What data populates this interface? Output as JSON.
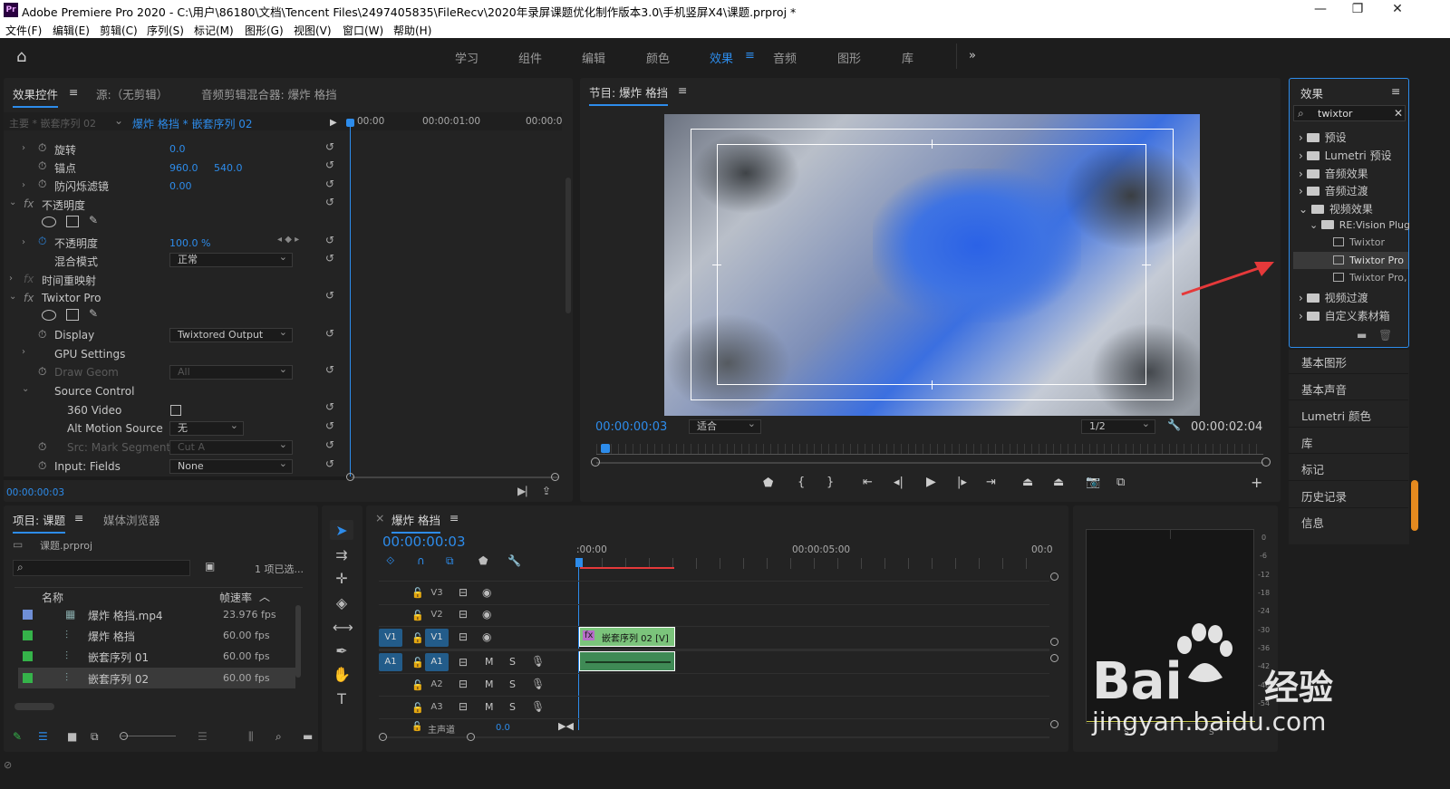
{
  "app": {
    "title": "Adobe Premiere Pro 2020 - C:\\用户\\86180\\文档\\Tencent Files\\2497405835\\FileRecv\\2020年录屏课题优化制作版本3.0\\手机竖屏X4\\课题.prproj *",
    "icon": "Pr"
  },
  "window_buttons": [
    "—",
    "❐",
    "✕"
  ],
  "menu": [
    "文件(F)",
    "编辑(E)",
    "剪辑(C)",
    "序列(S)",
    "标记(M)",
    "图形(G)",
    "视图(V)",
    "窗口(W)",
    "帮助(H)"
  ],
  "workspaces": [
    "学习",
    "组件",
    "编辑",
    "颜色",
    "效果",
    "音频",
    "图形",
    "库"
  ],
  "workspace_active": "效果",
  "effect_controls": {
    "tabs": [
      "效果控件",
      "源:（无剪辑）",
      "音频剪辑混合器: 爆炸 格挡"
    ],
    "source_label": "主要 * 嵌套序列 02",
    "clip_label": "爆炸 格挡 * 嵌套序列 02",
    "times": [
      "00:00",
      "00:00:01:00",
      "00:00:0"
    ],
    "rows": [
      {
        "name": "旋转",
        "value": "0.0"
      },
      {
        "name": "锚点",
        "value": "960.0",
        "value2": "540.0"
      },
      {
        "name": "防闪烁滤镜",
        "value": "0.00"
      },
      {
        "name": "不透明度",
        "section": true
      },
      {
        "name": "不透明度",
        "value": "100.0 %"
      },
      {
        "name": "混合模式",
        "dropdown": "正常"
      },
      {
        "name": "时间重映射",
        "section": true
      },
      {
        "name": "Twixtor Pro",
        "section": true
      },
      {
        "name": "Display",
        "dropdown": "Twixtored Output"
      },
      {
        "name": "GPU Settings"
      },
      {
        "name": "Draw Geom",
        "dropdown": "All"
      },
      {
        "name": "Source Control"
      },
      {
        "name": "360 Video"
      },
      {
        "name": "Alt Motion Source",
        "dropdown": "无"
      },
      {
        "name": "Src: Mark Segments",
        "dropdown": "Cut A"
      },
      {
        "name": "Input: Fields",
        "dropdown": "None"
      }
    ],
    "timecode": "00:00:00:03"
  },
  "program": {
    "title": "节目: 爆炸 格挡",
    "timecode": "00:00:00:03",
    "fit": "适合",
    "quality": "1/2",
    "duration": "00:00:02:04"
  },
  "effects": {
    "title": "效果",
    "search": "twixtor",
    "tree": [
      {
        "label": "预设",
        "level": 0
      },
      {
        "label": "Lumetri 预设",
        "level": 0
      },
      {
        "label": "音频效果",
        "level": 0
      },
      {
        "label": "音频过渡",
        "level": 0
      },
      {
        "label": "视频效果",
        "level": 0,
        "open": true
      },
      {
        "label": "RE:Vision Plug",
        "level": 1,
        "open": true
      },
      {
        "label": "Twixtor",
        "level": 2
      },
      {
        "label": "Twixtor Pro",
        "level": 2,
        "selected": true
      },
      {
        "label": "Twixtor Pro,",
        "level": 2
      },
      {
        "label": "视频过渡",
        "level": 0
      },
      {
        "label": "自定义素材箱",
        "level": 0
      }
    ]
  },
  "right_list": [
    "基本图形",
    "基本声音",
    "Lumetri 颜色",
    "库",
    "标记",
    "历史记录",
    "信息"
  ],
  "project": {
    "tabs": [
      "项目: 课题",
      "媒体浏览器"
    ],
    "file": "课题.prproj",
    "selected_count": "1 项已选...",
    "columns": [
      "名称",
      "帧速率"
    ],
    "items": [
      {
        "name": "爆炸 格挡.mp4",
        "fps": "23.976 fps",
        "color": "#6f8fd6"
      },
      {
        "name": "爆炸 格挡",
        "fps": "60.00 fps",
        "color": "#35b34a"
      },
      {
        "name": "嵌套序列 01",
        "fps": "60.00 fps",
        "color": "#35b34a"
      },
      {
        "name": "嵌套序列 02",
        "fps": "60.00 fps",
        "color": "#35b34a"
      }
    ]
  },
  "timeline": {
    "title": "爆炸 格挡",
    "timecode": "00:00:00:03",
    "ruler": [
      ":00:00",
      "00:00:05:00",
      "00:0"
    ],
    "tracks": [
      "V3",
      "V2",
      "V1",
      "A1",
      "A2",
      "A3"
    ],
    "src_v": "V1",
    "src_a": "A1",
    "clip": "嵌套序列 02 [V]",
    "master": "主声道",
    "master_val": "0.0"
  },
  "meter": {
    "ticks": [
      "0",
      "-6",
      "-12",
      "-18",
      "-24",
      "-30",
      "-36",
      "-42",
      "-48",
      "-54"
    ],
    "bottom": [
      "S",
      "S"
    ]
  },
  "watermark": {
    "text1": "Bai",
    "text2": "经验",
    "url": "jingyan.baidu.com"
  }
}
